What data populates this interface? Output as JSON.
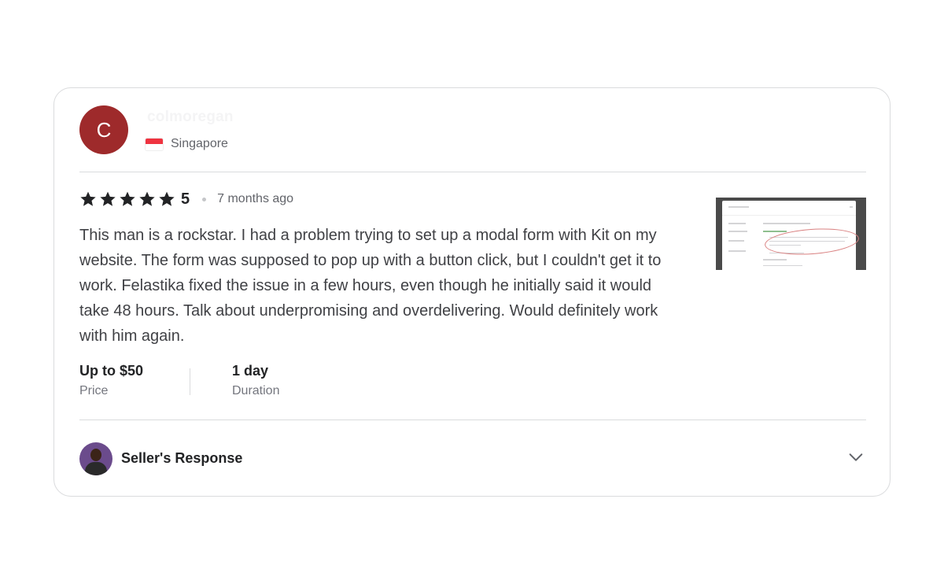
{
  "review": {
    "avatar_letter": "C",
    "avatar_color": "#9e2a2b",
    "username": "colmoregan",
    "country": "Singapore",
    "flag_icon": "singapore-flag-icon",
    "rating": "5",
    "stars": 5,
    "time_ago": "7 months ago",
    "text": "This man is a rockstar. I had a problem trying to set up a modal form with Kit on my website. The form was supposed to pop up with a button click, but I couldn't get it to work. Felastika fixed the issue in a few hours, even though he initially said it would take 48 hours. Talk about underpromising and overdelivering. Would definitely work with him again.",
    "attachment_icon": "screenshot-thumbnail",
    "price_value": "Up to $50",
    "price_label": "Price",
    "duration_value": "1 day",
    "duration_label": "Duration"
  },
  "seller_response": {
    "title": "Seller's Response",
    "avatar_icon": "seller-avatar",
    "toggle_icon": "chevron-down-icon"
  }
}
